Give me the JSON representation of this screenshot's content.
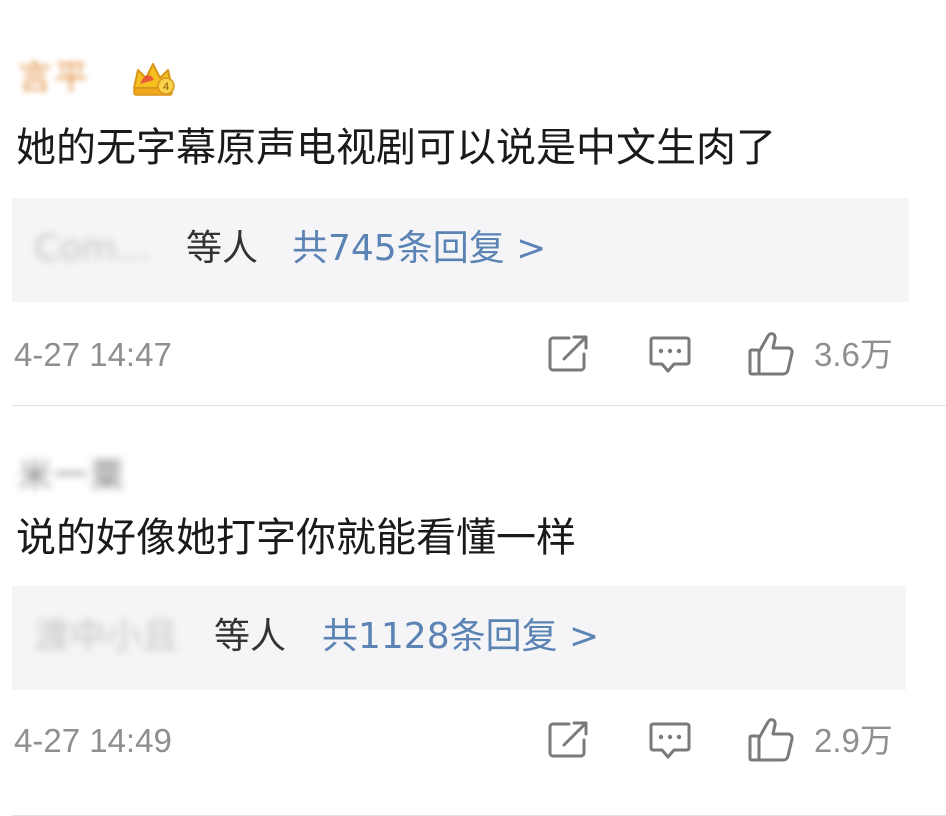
{
  "colors": {
    "accent": "#5b83b4",
    "username_vip": "#e0862f",
    "muted": "#8f8f8f",
    "reply_bg": "#f5f5f7"
  },
  "comments": [
    {
      "username": "言平",
      "badge_icon": "vip-crown-icon",
      "text": "她的无字幕原声电视剧可以说是中文生肉了",
      "reply_preview": {
        "users": "Com...",
        "etc_label": "等人",
        "count_label": "共745条回复 >"
      },
      "timestamp": "4-27 14:47",
      "actions": {
        "share_icon": "share-icon",
        "reply_icon": "comment-icon",
        "like_icon": "thumbs-up-icon",
        "like_count": "3.6万"
      }
    },
    {
      "username": "米一粟",
      "text": "说的好像她打字你就能看懂一样",
      "reply_preview": {
        "users": "渡中小且",
        "etc_label": "等人",
        "count_label": "共1128条回复 >"
      },
      "timestamp": "4-27 14:49",
      "actions": {
        "share_icon": "share-icon",
        "reply_icon": "comment-icon",
        "like_icon": "thumbs-up-icon",
        "like_count": "2.9万"
      }
    }
  ]
}
